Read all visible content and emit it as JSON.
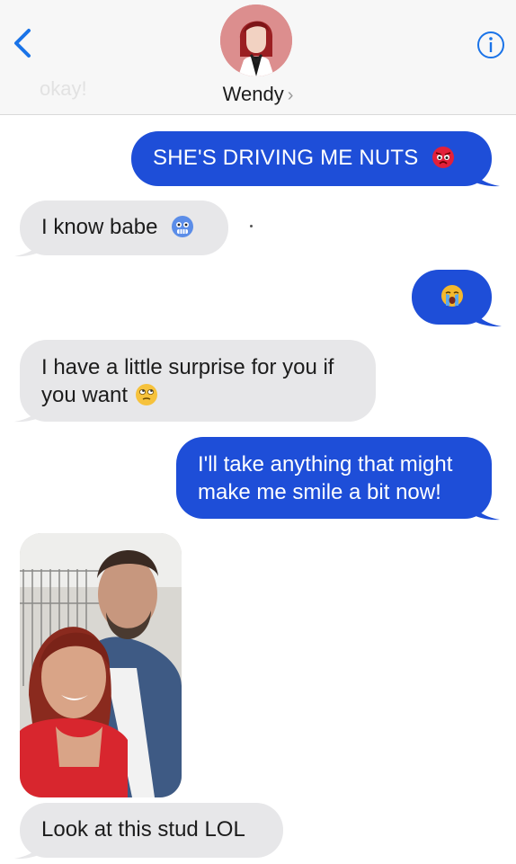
{
  "header": {
    "contact_name": "Wendy",
    "chevron": "›",
    "ghost_preview": "okay!",
    "back_icon": "chevron-left-icon",
    "info_icon": "info-circle-icon",
    "accent_color": "#1a73e8"
  },
  "messages": [
    {
      "direction": "outgoing",
      "text": "SHE'S DRIVING ME NUTS",
      "emoji": "angry-face-emoji"
    },
    {
      "direction": "incoming",
      "text": "I know babe",
      "emoji": "cold-face-emoji"
    },
    {
      "direction": "outgoing",
      "text": "",
      "emoji": "crying-face-emoji"
    },
    {
      "direction": "incoming",
      "text_line1": "I have a little surprise for you if",
      "text_line2": "you want",
      "emoji": "eye-roll-face-emoji"
    },
    {
      "direction": "outgoing",
      "text_line1": "I'll take anything that might",
      "text_line2": "make me smile a bit now!"
    },
    {
      "direction": "incoming",
      "type": "photo",
      "content": "selfie-photo"
    },
    {
      "direction": "incoming",
      "text": "Look at this stud LOL"
    }
  ],
  "colors": {
    "outgoing_bubble": "#1e4ed8",
    "incoming_bubble": "#e7e7e9"
  }
}
